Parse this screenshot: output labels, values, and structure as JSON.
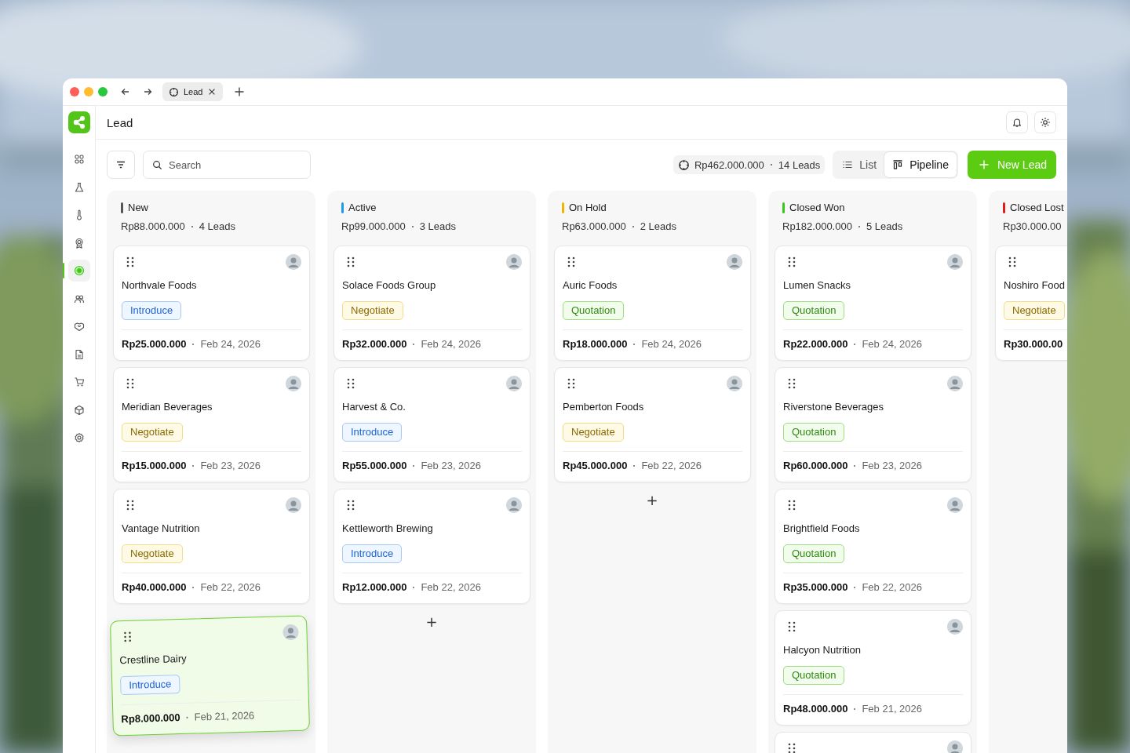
{
  "browser": {
    "tab_title": "Lead"
  },
  "sidebar": {
    "items": [
      {
        "selected": false
      },
      {
        "selected": false
      },
      {
        "selected": false
      },
      {
        "selected": false
      },
      {
        "selected": true
      },
      {
        "selected": false
      },
      {
        "selected": false
      },
      {
        "selected": false
      },
      {
        "selected": false
      },
      {
        "selected": false
      },
      {
        "selected": false
      }
    ]
  },
  "header": {
    "title": "Lead"
  },
  "toolbar": {
    "search": {
      "placeholder": "Search"
    },
    "summary": {
      "amount": "Rp462.000.000",
      "leads": "14 Leads"
    },
    "view_toggle": [
      {
        "label": "List",
        "selected": false
      },
      {
        "label": "Pipeline",
        "selected": true
      }
    ],
    "primary_button": "New Lead"
  },
  "columns": [
    {
      "name": "New",
      "color": "#555555",
      "amount": "Rp88.000.000",
      "leads": "4 Leads",
      "cards": [
        {
          "company": "Northvale Foods",
          "stage": {
            "label": "Introduce",
            "kind": "introduce"
          },
          "amount": "Rp25.000.000",
          "date": "Feb 24, 2026",
          "dragging": false
        },
        {
          "company": "Meridian Beverages",
          "stage": {
            "label": "Negotiate",
            "kind": "negotiate"
          },
          "amount": "Rp15.000.000",
          "date": "Feb 23, 2026",
          "dragging": false
        },
        {
          "company": "Vantage Nutrition",
          "stage": {
            "label": "Negotiate",
            "kind": "negotiate"
          },
          "amount": "Rp40.000.000",
          "date": "Feb 22, 2026",
          "dragging": false
        },
        {
          "company": "Crestline Dairy",
          "stage": {
            "label": "Introduce",
            "kind": "introduce"
          },
          "amount": "Rp8.000.000",
          "date": "Feb 21, 2026",
          "dragging": true
        }
      ]
    },
    {
      "name": "Active",
      "color": "#1e9bf0",
      "amount": "Rp99.000.000",
      "leads": "3 Leads",
      "add_button": "+",
      "cards": [
        {
          "company": "Solace Foods Group",
          "stage": {
            "label": "Negotiate",
            "kind": "negotiate"
          },
          "amount": "Rp32.000.000",
          "date": "Feb 24, 2026",
          "dragging": false
        },
        {
          "company": "Harvest & Co.",
          "stage": {
            "label": "Introduce",
            "kind": "introduce"
          },
          "amount": "Rp55.000.000",
          "date": "Feb 23, 2026",
          "dragging": false
        },
        {
          "company": "Kettleworth Brewing",
          "stage": {
            "label": "Introduce",
            "kind": "introduce"
          },
          "amount": "Rp12.000.000",
          "date": "Feb 22, 2026",
          "dragging": false
        }
      ]
    },
    {
      "name": "On Hold",
      "color": "#f0b400",
      "amount": "Rp63.000.000",
      "leads": "2 Leads",
      "add_button": "+",
      "cards": [
        {
          "company": "Auric Foods",
          "stage": {
            "label": "Quotation",
            "kind": "quotation"
          },
          "amount": "Rp18.000.000",
          "date": "Feb 24, 2026",
          "dragging": false
        },
        {
          "company": "Pemberton Foods",
          "stage": {
            "label": "Negotiate",
            "kind": "negotiate"
          },
          "amount": "Rp45.000.000",
          "date": "Feb 22, 2026",
          "dragging": false
        }
      ]
    },
    {
      "name": "Closed Won",
      "color": "#3cc51b",
      "amount": "Rp182.000.000",
      "leads": "5 Leads",
      "cards": [
        {
          "company": "Lumen Snacks",
          "stage": {
            "label": "Quotation",
            "kind": "quotation"
          },
          "amount": "Rp22.000.000",
          "date": "Feb 24, 2026",
          "dragging": false
        },
        {
          "company": "Riverstone Beverages",
          "stage": {
            "label": "Quotation",
            "kind": "quotation"
          },
          "amount": "Rp60.000.000",
          "date": "Feb 23, 2026",
          "dragging": false
        },
        {
          "company": "Brightfield Foods",
          "stage": {
            "label": "Quotation",
            "kind": "quotation"
          },
          "amount": "Rp35.000.000",
          "date": "Feb 22, 2026",
          "dragging": false
        },
        {
          "company": "Halcyon Nutrition",
          "stage": {
            "label": "Quotation",
            "kind": "quotation"
          },
          "amount": "Rp48.000.000",
          "date": "Feb 21, 2026",
          "dragging": false
        },
        {
          "dragging": false
        }
      ]
    },
    {
      "name": "Closed Lost",
      "color": "#e01b1b",
      "amount": "Rp30.000.00",
      "cards": [
        {
          "company": "Noshiro Food",
          "stage": {
            "label": "Negotiate",
            "kind": "negotiate"
          },
          "amount": "Rp30.000.00",
          "dragging": false
        }
      ]
    }
  ]
}
